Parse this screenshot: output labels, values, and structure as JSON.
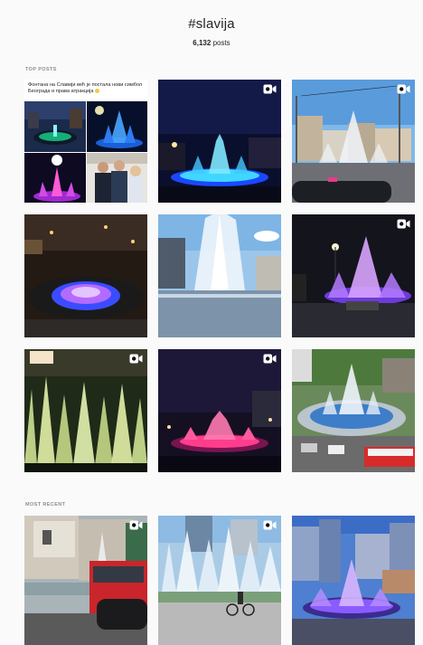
{
  "header": {
    "hashtag": "#slavija",
    "posts_count": "6,132",
    "posts_label": "posts"
  },
  "sections": {
    "top_posts": "TOP POSTS",
    "most_recent": "MOST RECENT"
  },
  "top_posts": [
    {
      "id": 1,
      "type": "image",
      "caption": "Фонтана на Славији већ је постала нови симбол Београда и права атракција"
    },
    {
      "id": 2,
      "type": "video",
      "icon": "video-camera-icon"
    },
    {
      "id": 3,
      "type": "video",
      "icon": "video-camera-icon"
    },
    {
      "id": 4,
      "type": "image"
    },
    {
      "id": 5,
      "type": "image"
    },
    {
      "id": 6,
      "type": "video",
      "icon": "video-camera-icon"
    },
    {
      "id": 7,
      "type": "video",
      "icon": "video-camera-icon"
    },
    {
      "id": 8,
      "type": "video",
      "icon": "video-camera-icon"
    },
    {
      "id": 9,
      "type": "image"
    }
  ],
  "most_recent": [
    {
      "id": 10,
      "type": "video",
      "icon": "video-camera-icon"
    },
    {
      "id": 11,
      "type": "video",
      "icon": "video-camera-icon"
    },
    {
      "id": 12,
      "type": "image"
    }
  ],
  "colors": {
    "background": "#fafafa",
    "text": "#262626",
    "muted": "#8e8e8e"
  }
}
